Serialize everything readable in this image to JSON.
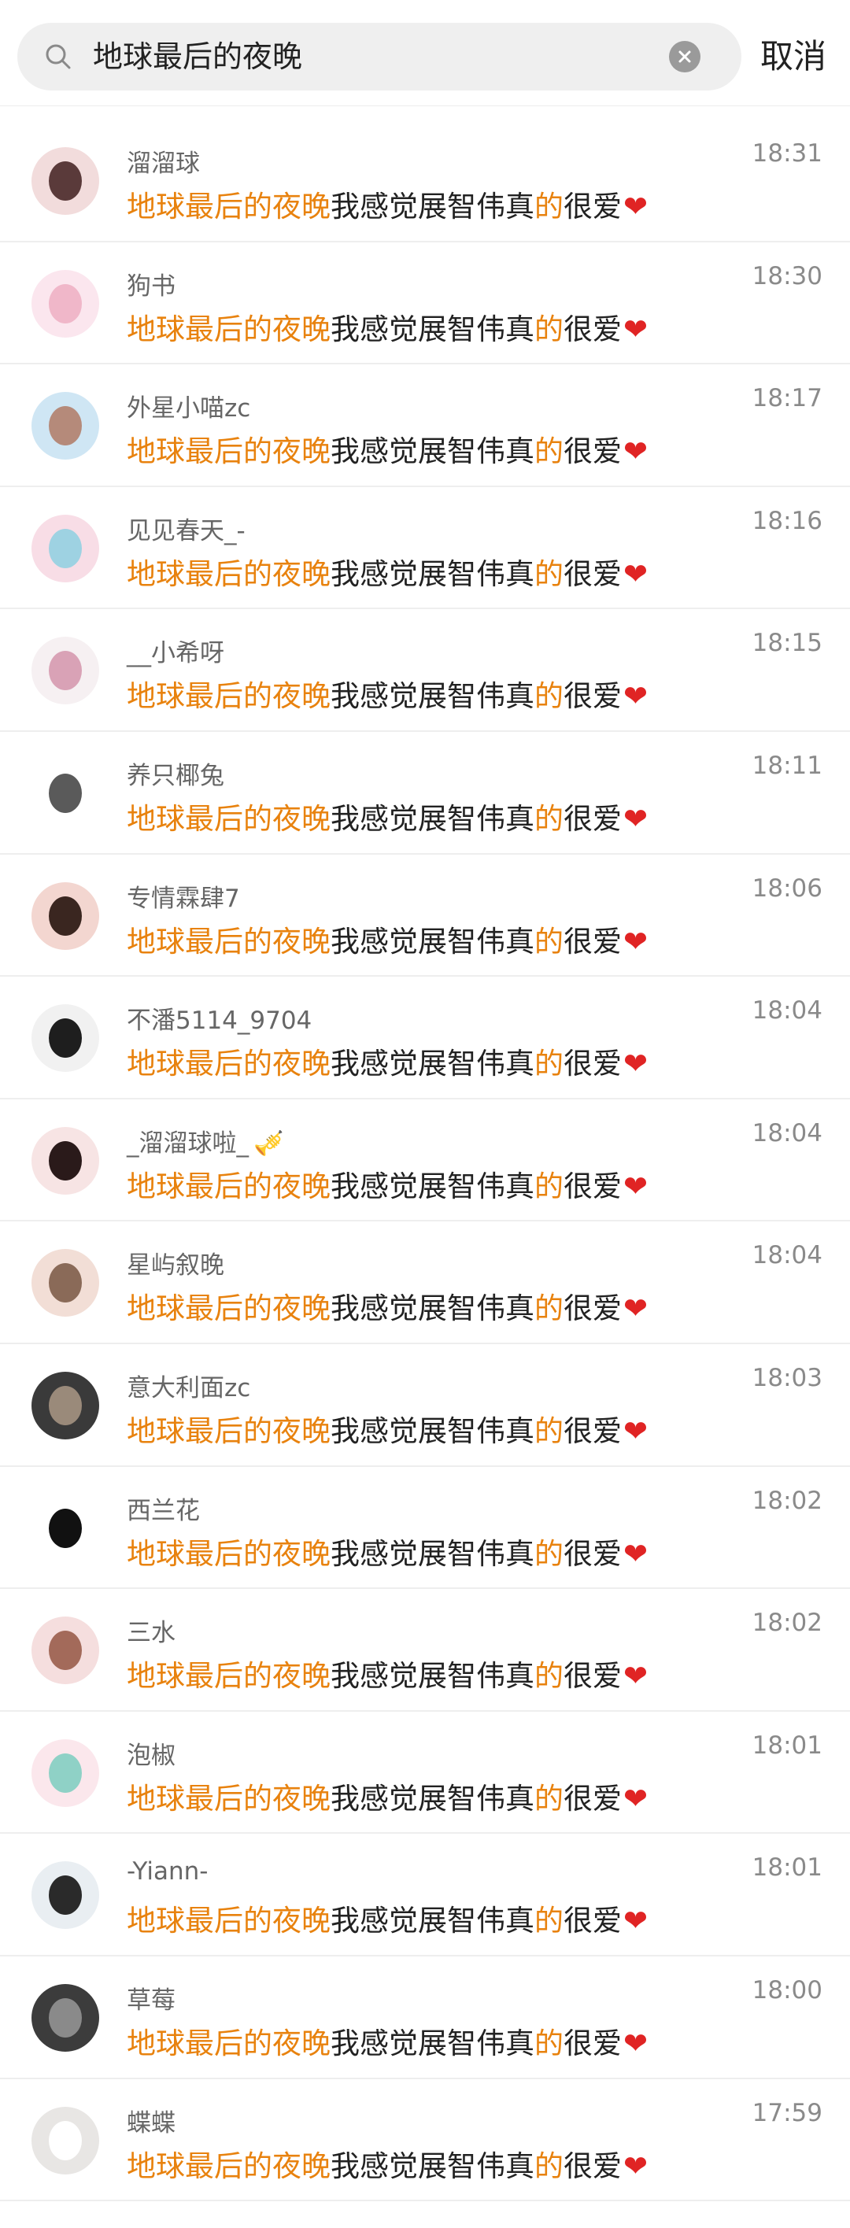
{
  "search": {
    "query": "地球最后的夜晚",
    "search_icon": "search-icon",
    "clear_icon": "clear-icon",
    "cancel_label": "取消"
  },
  "message": {
    "highlight": "地球最后的夜晚",
    "middle": "我感觉展智伟真",
    "highlight2": "的",
    "tail": "很爱",
    "emoji": "❤"
  },
  "colors": {
    "highlight": "#e8820e",
    "heart": "#e02424",
    "name": "#666666",
    "time": "#8a8a8a"
  },
  "results": [
    {
      "name": "溜溜球",
      "time": "18:31",
      "avatar": [
        "#f2dcdc",
        "#5a3a3a"
      ]
    },
    {
      "name": "狗书",
      "time": "18:30",
      "avatar": [
        "#fbe6ee",
        "#f0b7c9"
      ]
    },
    {
      "name": "外星小喵zc",
      "time": "18:17",
      "avatar": [
        "#cfe6f4",
        "#b58a7a"
      ]
    },
    {
      "name": "见见春天_-",
      "time": "18:16",
      "avatar": [
        "#f8dde6",
        "#9ed2e2"
      ]
    },
    {
      "name": "__小希呀",
      "time": "18:15",
      "avatar": [
        "#f6f0f2",
        "#d9a2b6"
      ]
    },
    {
      "name": "养只椰兔",
      "time": "18:11",
      "avatar": [
        "#ffffff",
        "#5a5a5a"
      ]
    },
    {
      "name": "专情霖肆7",
      "time": "18:06",
      "avatar": [
        "#f3d6d0",
        "#3a2620"
      ]
    },
    {
      "name": "不潘5114_9704",
      "time": "18:04",
      "avatar": [
        "#f1f1f1",
        "#1e1e1e"
      ]
    },
    {
      "name": "_溜溜球啦_",
      "time": "18:04",
      "avatar": [
        "#f7e4e4",
        "#2a1a1a"
      ],
      "deco": "🎺"
    },
    {
      "name": "星屿叙晚",
      "time": "18:04",
      "avatar": [
        "#f2ded6",
        "#8a6a58"
      ]
    },
    {
      "name": "意大利面zc",
      "time": "18:03",
      "avatar": [
        "#3a3a3a",
        "#9a8a7a"
      ]
    },
    {
      "name": "西兰花",
      "time": "18:02",
      "avatar": [
        "#ffffff",
        "#111111"
      ]
    },
    {
      "name": "三水",
      "time": "18:02",
      "avatar": [
        "#f5dede",
        "#a36a5a"
      ]
    },
    {
      "name": "泡椒",
      "time": "18:01",
      "avatar": [
        "#fbe7ec",
        "#8fd1c6"
      ]
    },
    {
      "name": "-Yiann-",
      "time": "18:01",
      "avatar": [
        "#e9eef2",
        "#2a2a2a"
      ]
    },
    {
      "name": "草莓",
      "time": "18:00",
      "avatar": [
        "#3c3c3c",
        "#8a8a8a"
      ]
    },
    {
      "name": "蝶蝶",
      "time": "17:59",
      "avatar": [
        "#e8e6e4",
        "#ffffff"
      ]
    }
  ]
}
